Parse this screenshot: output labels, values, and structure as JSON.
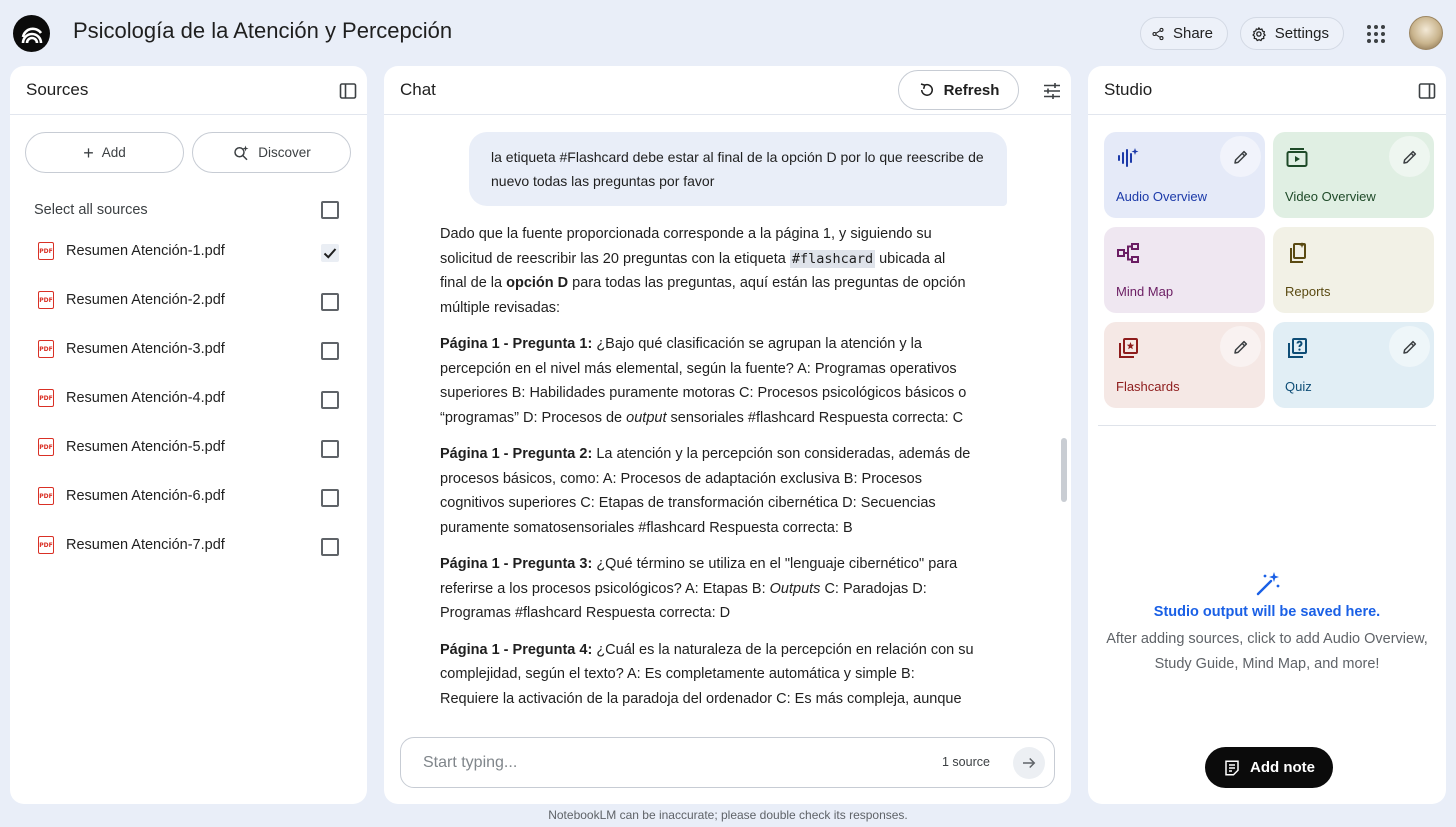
{
  "header": {
    "title": "Psicología de la Atención y Percepción",
    "share_label": "Share",
    "settings_label": "Settings"
  },
  "sources": {
    "title": "Sources",
    "add_label": "Add",
    "discover_label": "Discover",
    "select_all_label": "Select all sources",
    "items": [
      {
        "name": "Resumen Atención-1.pdf",
        "checked": true
      },
      {
        "name": "Resumen Atención-2.pdf",
        "checked": false
      },
      {
        "name": "Resumen Atención-3.pdf",
        "checked": false
      },
      {
        "name": "Resumen Atención-4.pdf",
        "checked": false
      },
      {
        "name": "Resumen Atención-5.pdf",
        "checked": false
      },
      {
        "name": "Resumen Atención-6.pdf",
        "checked": false
      },
      {
        "name": "Resumen Atención-7.pdf",
        "checked": false
      }
    ],
    "pdf_badge": "PDF"
  },
  "chat": {
    "title": "Chat",
    "refresh_label": "Refresh",
    "user_message": "la etiqueta #Flashcard debe estar al final de la opción D por lo que reescribe de nuevo todas las preguntas por favor",
    "intro": {
      "t1": "Dado que la fuente proporcionada corresponde a la página 1, y siguiendo su solicitud de reescribir las 20 preguntas con la etiqueta ",
      "code": "#flashcard",
      "t2": " ubicada al final de la ",
      "bold": "opción D",
      "t3": " para todas las preguntas, aquí están las preguntas de opción múltiple revisadas:"
    },
    "q1": {
      "head": "Página 1 - Pregunta 1:",
      "t1": " ¿Bajo qué clasificación se agrupan la atención y la percepción en el nivel más elemental, según la fuente? A: Programas operativos superiores B: Habilidades puramente motoras C: Procesos psicológicos básicos o “programas” D: Procesos de ",
      "em": "output",
      "t2": " sensoriales #flashcard Respuesta correcta: C"
    },
    "q2": {
      "head": "Página 1 - Pregunta 2:",
      "t1": " La atención y la percepción son consideradas, además de procesos básicos, como: A: Procesos de adaptación exclusiva B: Procesos cognitivos superiores C: Etapas de transformación cibernética D: Secuencias puramente somatosensoriales #flashcard Respuesta correcta: B"
    },
    "q3": {
      "head": "Página 1 - Pregunta 3:",
      "t1": " ¿Qué término se utiliza en el \"lenguaje cibernético\" para referirse a los procesos psicológicos? A: Etapas B: ",
      "em": "Outputs",
      "t2": " C: Paradojas D: Programas #flashcard Respuesta correcta: D"
    },
    "q4": {
      "head": "Página 1 - Pregunta 4:",
      "t1": " ¿Cuál es la naturaleza de la percepción en relación con su complejidad, según el texto? A: Es completamente automática y simple B: Requiere la activación de la paradoja del ordenador C: Es más compleja, aunque"
    },
    "composer_placeholder": "Start typing...",
    "source_count": "1 source"
  },
  "studio": {
    "title": "Studio",
    "tiles": [
      {
        "label": "Audio Overview",
        "bg": "#e5eaf8",
        "color": "#1c3aa9",
        "icon": "audio-waveform-icon"
      },
      {
        "label": "Video Overview",
        "bg": "#e0efe3",
        "color": "#1e4a28",
        "icon": "video-play-icon"
      },
      {
        "label": "Mind Map",
        "bg": "#efe7f1",
        "color": "#6b1d63",
        "icon": "mind-map-icon"
      },
      {
        "label": "Reports",
        "bg": "#f2f1e6",
        "color": "#5a4a12",
        "icon": "reports-icon"
      },
      {
        "label": "Flashcards",
        "bg": "#f5e8e5",
        "color": "#8e1c1c",
        "icon": "flashcards-icon"
      },
      {
        "label": "Quiz",
        "bg": "#e1eef5",
        "color": "#0e4d76",
        "icon": "quiz-icon"
      }
    ],
    "empty_title": "Studio output will be saved here.",
    "empty_desc": "After adding sources, click to add Audio Overview, Study Guide, Mind Map, and more!",
    "add_note_label": "Add note"
  },
  "footer": "NotebookLM can be inaccurate; please double check its responses."
}
